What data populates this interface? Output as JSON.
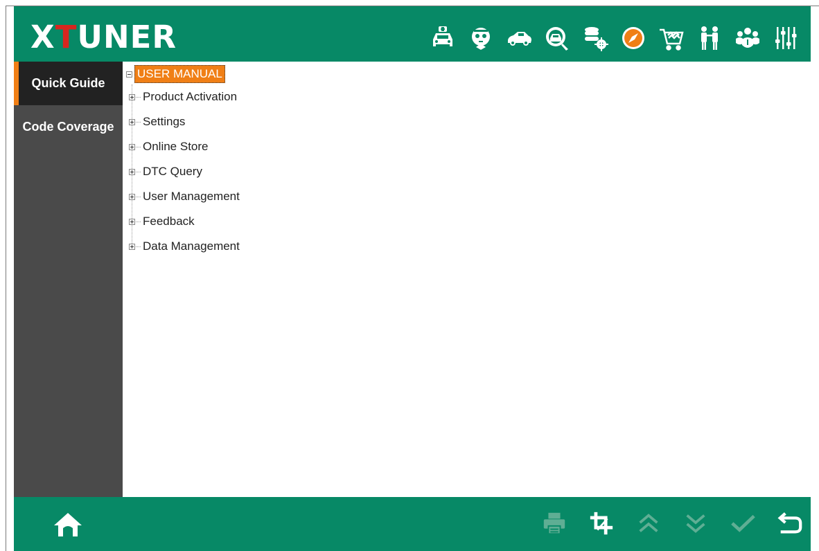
{
  "brand": {
    "part1": "X",
    "part2": "T",
    "part3": "UNER",
    "accent_color": "#d7261f"
  },
  "colors": {
    "header": "#078966",
    "sidebar": "#4a4a4a",
    "active": "#222222",
    "highlight": "#f07f16"
  },
  "nav_icons": [
    "vehicle-service-icon",
    "doctor-icon",
    "car-icon",
    "diagnostic-search-icon",
    "database-settings-icon",
    "compass-icon",
    "shopping-cart-icon",
    "technicians-icon",
    "user-group-icon",
    "sliders-icon"
  ],
  "sidebar": {
    "items": [
      {
        "label": "Quick Guide",
        "active": true
      },
      {
        "label": "Code Coverage",
        "active": false
      }
    ]
  },
  "tree": {
    "root": "USER MANUAL",
    "children": [
      "Product Activation",
      "Settings",
      "Online Store",
      "DTC Query",
      "User Management",
      "Feedback",
      "Data Management"
    ]
  },
  "footer": {
    "home_icon": "home-icon",
    "tools": [
      {
        "icon": "print-icon",
        "enabled": false
      },
      {
        "icon": "crop-icon",
        "enabled": true
      },
      {
        "icon": "page-up-icon",
        "enabled": false
      },
      {
        "icon": "page-down-icon",
        "enabled": false
      },
      {
        "icon": "confirm-icon",
        "enabled": false
      },
      {
        "icon": "back-icon",
        "enabled": true
      }
    ]
  }
}
